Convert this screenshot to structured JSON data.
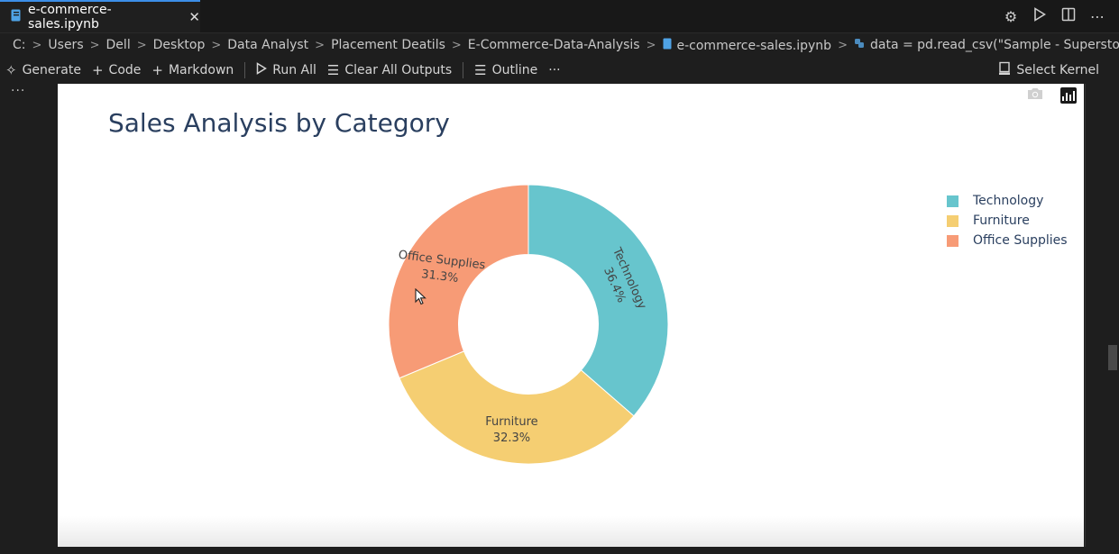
{
  "tab": {
    "title": "e-commerce-sales.ipynb"
  },
  "icons": {
    "notebook": "notebook-icon",
    "close": "close-icon",
    "settings": "gear-icon",
    "run": "run-icon",
    "split": "split-editor-icon",
    "more": "more-icon",
    "python": "python-icon"
  },
  "breadcrumb": {
    "items": [
      "C:",
      "Users",
      "Dell",
      "Desktop",
      "Data Analyst",
      "Placement Deatils",
      "E-Commerce-Data-Analysis"
    ],
    "file": "e-commerce-sales.ipynb",
    "code": "data = pd.read_csv(\"Sample - Superstore.csv\",encoding"
  },
  "toolbar": {
    "generate": "Generate",
    "code": "Code",
    "markdown": "Markdown",
    "run_all": "Run All",
    "clear_outputs": "Clear All Outputs",
    "outline": "Outline",
    "more": "···",
    "select_kernel": "Select Kernel"
  },
  "cell": {
    "dots": "···"
  },
  "colors": {
    "accent": "#3c8fe8",
    "plot_text": "#2a3f5f"
  },
  "chart_data": {
    "type": "pie",
    "title": "Sales Analysis by Category",
    "hole": 0.5,
    "legend_position": "top-right",
    "categories": [
      "Technology",
      "Furniture",
      "Office Supplies"
    ],
    "values": [
      36.4,
      32.3,
      31.3
    ],
    "labels": [
      {
        "name": "Technology",
        "percent": "36.4%"
      },
      {
        "name": "Furniture",
        "percent": "32.3%"
      },
      {
        "name": "Office Supplies",
        "percent": "31.3%"
      }
    ],
    "colors": [
      "#67c5cd",
      "#f5ce72",
      "#f79b76"
    ]
  }
}
